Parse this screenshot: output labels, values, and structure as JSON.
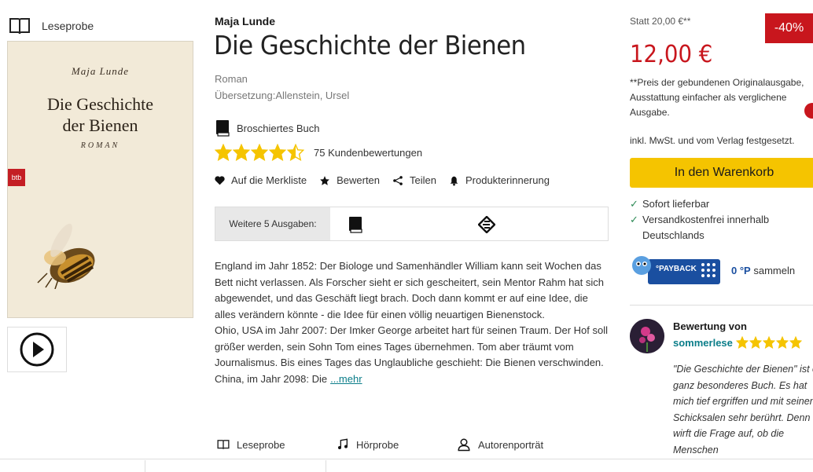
{
  "leseprobe_top": "Leseprobe",
  "cover": {
    "author": "Maja Lunde",
    "title_line1": "Die Geschichte",
    "title_line2": "der Bienen",
    "genre": "ROMAN",
    "publisher_badge": "btb"
  },
  "product": {
    "author": "Maja Lunde",
    "title": "Die Geschichte der Bienen",
    "genre": "Roman",
    "translation": "Übersetzung:Allenstein, Ursel",
    "format": "Broschiertes Buch",
    "rating_stars": 4.5,
    "rating_count": "75 Kundenbewertungen"
  },
  "actions": {
    "wishlist": "Auf die Merkliste",
    "rate": "Bewerten",
    "share": "Teilen",
    "reminder": "Produkterinnerung"
  },
  "editions": {
    "label": "Weitere 5 Ausgaben:",
    "icons": [
      "book-icon",
      "ebook-icon"
    ]
  },
  "description": {
    "text": "England im Jahr 1852: Der Biologe und Samenhändler William kann seit Wochen das Bett nicht verlassen. Als Forscher sieht er sich gescheitert, sein Mentor Rahm hat sich abgewendet, und das Geschäft liegt brach. Doch dann kommt er auf eine Idee, die alles verändern könnte - die Idee für einen völlig neuartigen Bienenstock.",
    "text2": "Ohio, USA im Jahr 2007: Der Imker George arbeitet hart für seinen Traum. Der Hof soll größer werden, sein Sohn Tom eines Tages übernehmen. Tom aber träumt vom Journalismus. Bis eines Tages das Unglaubliche geschieht: Die Bienen verschwinden.",
    "text3": "China, im Jahr 2098: Die",
    "more": "...mehr"
  },
  "bottom_tools": {
    "leseprobe": "Leseprobe",
    "hoerprobe": "Hörprobe",
    "autorenportraet": "Autorenporträt"
  },
  "pricing": {
    "old_price": "Statt 20,00 €**",
    "discount": "-40%",
    "price": "12,00 €",
    "note": "**Preis der gebundenen Originalausgabe, Ausstattung einfacher als verglichene Ausgabe.",
    "tax": "inkl. MwSt. und vom Verlag festgesetzt.",
    "cart_button": "In den Warenkorb",
    "availability": "Sofort lieferbar",
    "shipping_line1": "Versandkostenfrei innerhalb",
    "shipping_line2": "Deutschlands",
    "payback_logo": "°PAYBACK",
    "payback_points": "0 °P",
    "payback_label": "sammeln",
    "accent_color": "#c8161d",
    "button_color": "#f5c400"
  },
  "review": {
    "heading": "Bewertung von",
    "user": "sommerlese",
    "stars": 5,
    "text": "\"Die Geschichte der Bienen\" ist ein ganz besonderes Buch. Es hat mich tief ergriffen und mit seinen Schicksalen sehr berührt. Denn es wirft die Frage auf, ob die Menschen"
  }
}
